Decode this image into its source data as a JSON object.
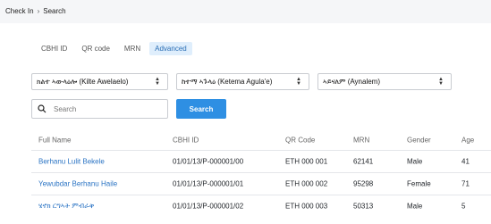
{
  "breadcrumb": {
    "items": [
      "Check In",
      "Search"
    ],
    "separator": "›"
  },
  "tabs": [
    {
      "label": "CBHI ID",
      "active": false
    },
    {
      "label": "QR code",
      "active": false
    },
    {
      "label": "MRN",
      "active": false
    },
    {
      "label": "Advanced",
      "active": true
    }
  ],
  "filters": {
    "kilte": "ክልተ ኣውላዕሎ (Kilte Awelaelo)",
    "ketema": "ከተማ ኣጉላዕ (Ketema Agula'e)",
    "aynalem": "ኣይናለም (Aynalem)"
  },
  "search": {
    "placeholder": "Search",
    "button_label": "Search"
  },
  "table": {
    "headers": [
      "Full Name",
      "CBHI ID",
      "QR Code",
      "MRN",
      "Gender",
      "Age"
    ],
    "rows": [
      [
        "Berhanu Lulit Bekele",
        "01/01/13/P-000001/00",
        "ETH 000 001",
        "62141",
        "Male",
        "41"
      ],
      [
        "Yewubdar Berhanu Haile",
        "01/01/13/P-000001/01",
        "ETH 000 002",
        "95298",
        "Female",
        "71"
      ],
      [
        "ሄኖክ ርግኣት ምብራቅ",
        "01/01/13/P-000001/02",
        "ETH 000 003",
        "50313",
        "Male",
        "5"
      ]
    ]
  },
  "colors": {
    "accent": "#2e8fe3",
    "link": "#2b74c4",
    "active_tab_bg": "#dfeefc"
  }
}
